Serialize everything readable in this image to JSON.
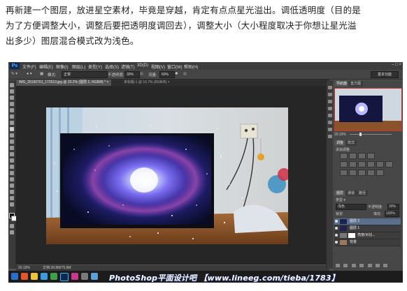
{
  "caption": {
    "line1": "再新建一个图层，放进星空素材，毕竟是穿越，肯定有点点星光溢出。调低透明度（目的是",
    "line2": "为了方便调整大小，调整后要把透明度调回去），调整大小（大小程度取决于你想让星光溢",
    "line3": "出多少）图层混合模式改为浅色。"
  },
  "ps": {
    "logo": "Ps",
    "menus": [
      "文件(F)",
      "编辑(E)",
      "图像(I)",
      "图层(L)",
      "类型(Y)",
      "选择(S)",
      "滤镜(T)",
      "3D(D)",
      "视图(V)",
      "窗口(W)",
      "帮助(H)"
    ],
    "options": {
      "mode_label": "模式:",
      "mode_value": "正常",
      "opacity_label": "不透明度:",
      "opacity_value": "30%",
      "flow_label": "流量:",
      "flow_value": "60%",
      "workspace": "基本功能"
    },
    "tabs": [
      {
        "label": "IMG_20150701_172513.jpg @ 20.2% (图层 2, RGB/8) * ×"
      },
      {
        "label": "未标题-1 @ 16.7% (RGB/8) ×"
      }
    ],
    "status": {
      "zoom": "20.19%",
      "doc": "文档:28.8M/75.8M"
    },
    "panels": {
      "nav_tab": "导航器",
      "hist_tab": "直方图",
      "nav_zoom": "20.19%",
      "adj_tab": "调整",
      "styles_tab": "样式",
      "adj_title": "添加调整",
      "layers_tab": "图层",
      "channels_tab": "通道",
      "paths_tab": "路径",
      "kind_label": "类型",
      "blend": "浅色",
      "opacity_label": "不透明度:",
      "opacity_value": "30%",
      "lock_label": "锁定:",
      "fill_label": "填充:",
      "fill_value": "100%",
      "layers": [
        {
          "name": "图层 2",
          "selected": true
        },
        {
          "name": "图层 1",
          "selected": false
        },
        {
          "name": "亮度/对比...",
          "selected": false
        },
        {
          "name": "背景",
          "selected": false
        }
      ]
    },
    "watermark": "PhotoShop平面设计吧 【www.lineeg.com/tieba/1783】",
    "colors": {
      "ui_dark": "#535353",
      "panel": "#474747",
      "selected_layer": "#5a6f8c",
      "accent_red": "#cc3333"
    }
  }
}
